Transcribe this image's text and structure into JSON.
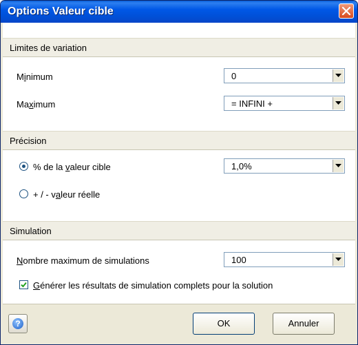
{
  "window": {
    "title": "Options Valeur cible"
  },
  "sections": {
    "limites": "Limites de variation",
    "precision": "Précision",
    "simulation": "Simulation"
  },
  "minimum": {
    "label_pre": "M",
    "label_u": "i",
    "label_post": "nimum",
    "value": "0"
  },
  "maximum": {
    "label_pre": "Ma",
    "label_u": "x",
    "label_post": "imum",
    "value": "= INFINI +"
  },
  "precision": {
    "radio1": {
      "label_pre": "% de la ",
      "label_u": "v",
      "label_post": "aleur cible",
      "selected": true
    },
    "radio2": {
      "label_pre": "+ / - v",
      "label_u": "a",
      "label_post": "leur réelle",
      "selected": false
    },
    "value": "1,0%"
  },
  "simulation": {
    "label_u": "N",
    "label_post": "ombre maximum de simulations",
    "value": "100",
    "checkbox": {
      "label_u": "G",
      "label_post": "énérer les résultats de simulation complets pour la solution",
      "checked": true
    }
  },
  "buttons": {
    "ok": "OK",
    "cancel": "Annuler",
    "help": "?"
  },
  "colors": {
    "titlebar": "#0058e6",
    "close": "#d84a1e",
    "panel": "#ece9d8"
  },
  "icons": {
    "close": "close-icon",
    "dropdown": "chevron-down-icon",
    "help": "help-icon",
    "check": "check-icon"
  }
}
